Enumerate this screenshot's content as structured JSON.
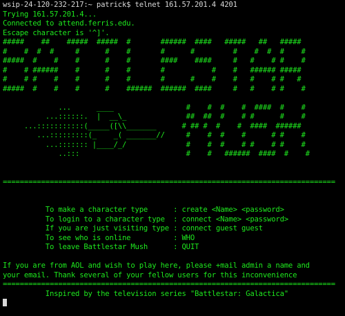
{
  "colors": {
    "background": "#000000",
    "text_white": "#d8d8d8",
    "text_green": "#1ee81e"
  },
  "lines": [
    {
      "text": "wsip-24-120-232-217:~ patrick$ telnet 161.57.201.4 4201",
      "color": "white"
    },
    {
      "text": "Trying 161.57.201.4...",
      "color": "green"
    },
    {
      "text": "Connected to attend.ferris.edu.",
      "color": "green"
    },
    {
      "text": "Escape character is '^]'.",
      "color": "green"
    },
    {
      "text": "#####    ##    #####  #####  #       ######  ####   #####   ##   #####",
      "color": "green"
    },
    {
      "text": "#    #  #  #     #      #    #       #      #         #    #  #  #    #",
      "color": "green"
    },
    {
      "text": "#####  #    #    #      #    #       ####    ####     #   #    # #    #",
      "color": "green"
    },
    {
      "text": "#    # ######    #      #    #       #           #    #   ###### #####",
      "color": "green"
    },
    {
      "text": "#    # #    #    #      #    #       #      #    #    #   #    # #   #",
      "color": "green"
    },
    {
      "text": "#####  #    #    #      #    ######  ######  ####     #   #    # #    #",
      "color": "green"
    },
    {
      "text": "",
      "color": "green"
    },
    {
      "text": "             ...      ____                 #    #  #    #  ####  #    #",
      "color": "green"
    },
    {
      "text": "          ...::::::.  |  __\\_              ##  ##  #    # #      #    #",
      "color": "green"
    },
    {
      "text": "     ...:::::::::::(_____([\\\\_______      # ## #  #    #  ####  ######",
      "color": "green"
    },
    {
      "text": "        ...:::::::::(_    _( _______//     #    #  #    #      # #    #",
      "color": "green"
    },
    {
      "text": "          ...::::::: |____/_/              #    #  #    # #    # #    #",
      "color": "green"
    },
    {
      "text": "             ..:::                         #    #   ######  ####  #    #",
      "color": "green"
    },
    {
      "text": "",
      "color": "green"
    },
    {
      "text": "",
      "color": "green"
    },
    {
      "text": "==============================================================================",
      "color": "green"
    },
    {
      "text": "",
      "color": "green"
    },
    {
      "text": "",
      "color": "green"
    },
    {
      "text": "          To make a character type      : create <Name> <password>",
      "color": "green"
    },
    {
      "text": "          To login to a character type  : connect <Name> <password>",
      "color": "green"
    },
    {
      "text": "          If you are just visiting type : connect guest guest",
      "color": "green"
    },
    {
      "text": "          To see who is online          : WHO",
      "color": "green"
    },
    {
      "text": "          To leave Battlestar Mush      : QUIT",
      "color": "green"
    },
    {
      "text": "",
      "color": "green"
    },
    {
      "text": "If you are from AOL and wish to play here, please +mail admin a name and",
      "color": "green"
    },
    {
      "text": "your email. Thank several of your fellow users for this inconvenience",
      "color": "green"
    },
    {
      "text": "==============================================================================",
      "color": "green"
    },
    {
      "text": "          Inspired by the television series \"Battlestar: Galactica\"",
      "color": "green"
    },
    {
      "text": "",
      "color": "green",
      "cursor": true
    }
  ]
}
